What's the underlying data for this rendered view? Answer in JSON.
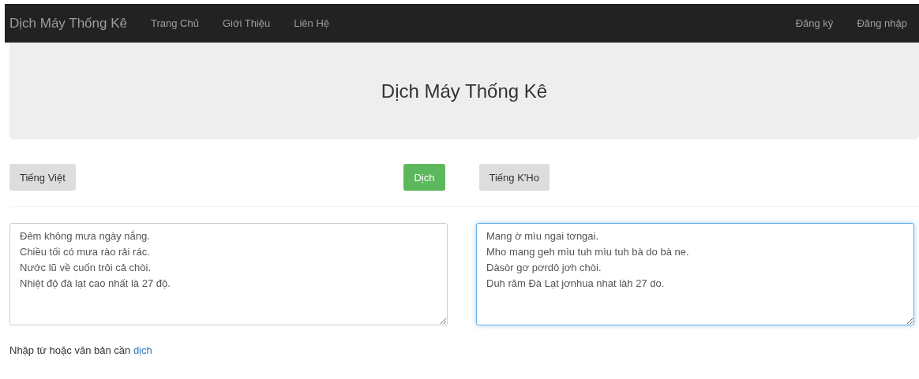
{
  "navbar": {
    "brand": "Dịch Máy Thống Kê",
    "links": [
      "Trang Chủ",
      "Giới Thiệu",
      "Liên Hệ"
    ],
    "right_links": [
      "Đăng ký",
      "Đăng nhập"
    ]
  },
  "jumbotron": {
    "title": "Dịch Máy Thống Kê"
  },
  "source_language": "Tiếng Việt",
  "translate_button": "Dịch",
  "target_language": "Tiếng K'Ho",
  "source_text": {
    "value": "Đêm không mưa ngày nắng.\nChiều tối có mưa rào rải rác.\nNước lũ về cuốn trôi cả chòi.\nNhiệt độ đà lạt cao nhất là 27 độ.",
    "focused": false
  },
  "target_text": {
    "value": "Mang ờ mìu ngai tơngai.\nMho mang geh mìu tuh mìu tuh bà do bà ne.\nDàsòr gơ pơrdô jơh chòi.\nDuh răm Đà Lạt jơnhua nhat làh 27 do.",
    "focused": true
  },
  "hint": {
    "text": "Nhập từ hoặc văn bản cần",
    "link": "dịch"
  }
}
